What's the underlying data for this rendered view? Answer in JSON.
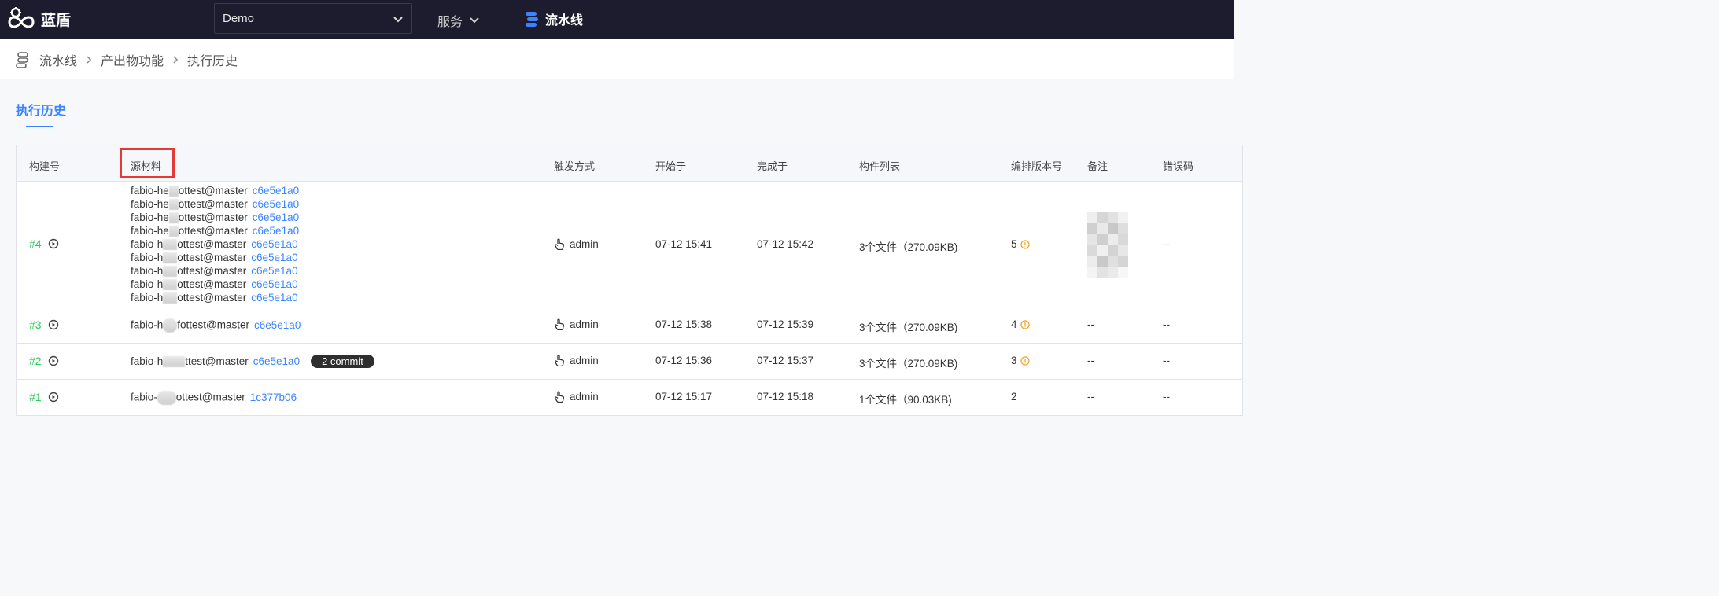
{
  "header": {
    "brand": "蓝盾",
    "project_select": "Demo",
    "nav_services": "服务",
    "nav_pipeline": "流水线"
  },
  "breadcrumb": [
    "流水线",
    "产出物功能",
    "执行历史"
  ],
  "page": {
    "title": "执行历史"
  },
  "table": {
    "columns": [
      "构建号",
      "源材料",
      "触发方式",
      "开始于",
      "完成于",
      "构件列表",
      "编排版本号",
      "备注",
      "错误码"
    ],
    "rows": [
      {
        "build": "#4",
        "sources": [
          {
            "pre": "fabio-he",
            "post": "ottest@master",
            "hash": "c6e5e1a0"
          },
          {
            "pre": "fabio-he",
            "post": "ottest@master",
            "hash": "c6e5e1a0"
          },
          {
            "pre": "fabio-he",
            "post": "ottest@master",
            "hash": "c6e5e1a0"
          },
          {
            "pre": "fabio-he",
            "post": "ottest@master",
            "hash": "c6e5e1a0"
          },
          {
            "pre": "fabio-h",
            "post": "ottest@master",
            "hash": "c6e5e1a0"
          },
          {
            "pre": "fabio-h",
            "post": "ottest@master",
            "hash": "c6e5e1a0"
          },
          {
            "pre": "fabio-h",
            "post": "ottest@master",
            "hash": "c6e5e1a0"
          },
          {
            "pre": "fabio-h",
            "post": "ottest@master",
            "hash": "c6e5e1a0"
          },
          {
            "pre": "fabio-h",
            "post": "ottest@master",
            "hash": "c6e5e1a0"
          }
        ],
        "trigger": "admin",
        "start": "07-12 15:41",
        "end": "07-12 15:42",
        "artifacts": "3个文件（270.09KB)",
        "version": "5",
        "note": "",
        "error": "--"
      },
      {
        "build": "#3",
        "sources": [
          {
            "pre": "fabio-h",
            "post": "fottest@master",
            "hash": "c6e5e1a0"
          }
        ],
        "trigger": "admin",
        "start": "07-12 15:38",
        "end": "07-12 15:39",
        "artifacts": "3个文件（270.09KB)",
        "version": "4",
        "note": "--",
        "error": "--"
      },
      {
        "build": "#2",
        "sources": [
          {
            "pre": "fabio-h",
            "post": "ttest@master",
            "hash": "c6e5e1a0",
            "badge": "2 commit"
          }
        ],
        "trigger": "admin",
        "start": "07-12 15:36",
        "end": "07-12 15:37",
        "artifacts": "3个文件（270.09KB)",
        "version": "3",
        "note": "--",
        "error": "--"
      },
      {
        "build": "#1",
        "sources": [
          {
            "pre": "fabio-",
            "post": "ottest@master",
            "hash": "1c377b06"
          }
        ],
        "trigger": "admin",
        "start": "07-12 15:17",
        "end": "07-12 15:18",
        "artifacts": "1个文件（90.03KB)",
        "version": "2",
        "note": "--",
        "error": "--"
      }
    ]
  },
  "colors": {
    "accent": "#3a84ff",
    "build_link": "#2dcb56",
    "highlight_box": "#e53935",
    "topbar": "#1c1c2e"
  }
}
